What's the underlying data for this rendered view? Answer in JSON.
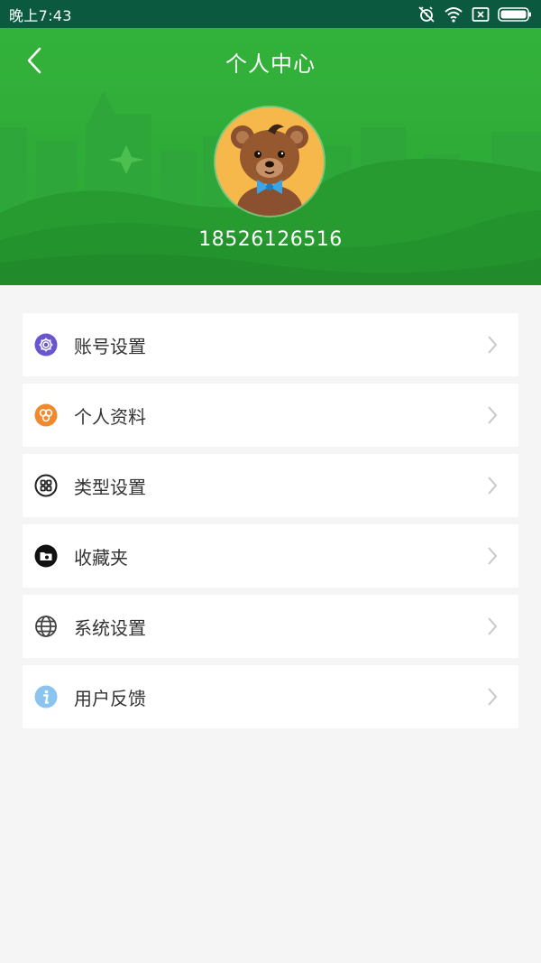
{
  "status_bar": {
    "time": "晚上7:43",
    "icons": [
      "alarm-off-icon",
      "wifi-icon",
      "sim-x-icon",
      "battery-icon"
    ]
  },
  "header": {
    "title": "个人中心",
    "back_icon": "chevron-left-icon",
    "phone": "18526126516",
    "background_color": "#2ea83a"
  },
  "menu": {
    "items": [
      {
        "label": "账号设置",
        "icon": "gear-icon",
        "icon_color": "#6a55d0"
      },
      {
        "label": "个人资料",
        "icon": "profile-icon",
        "icon_color": "#f08a2c"
      },
      {
        "label": "类型设置",
        "icon": "grid-icon",
        "icon_color": "#222222"
      },
      {
        "label": "收藏夹",
        "icon": "folder-icon",
        "icon_color": "#111111"
      },
      {
        "label": "系统设置",
        "icon": "globe-icon",
        "icon_color": "#444444"
      },
      {
        "label": "用户反馈",
        "icon": "info-icon",
        "icon_color": "#8ac4ef"
      }
    ]
  }
}
